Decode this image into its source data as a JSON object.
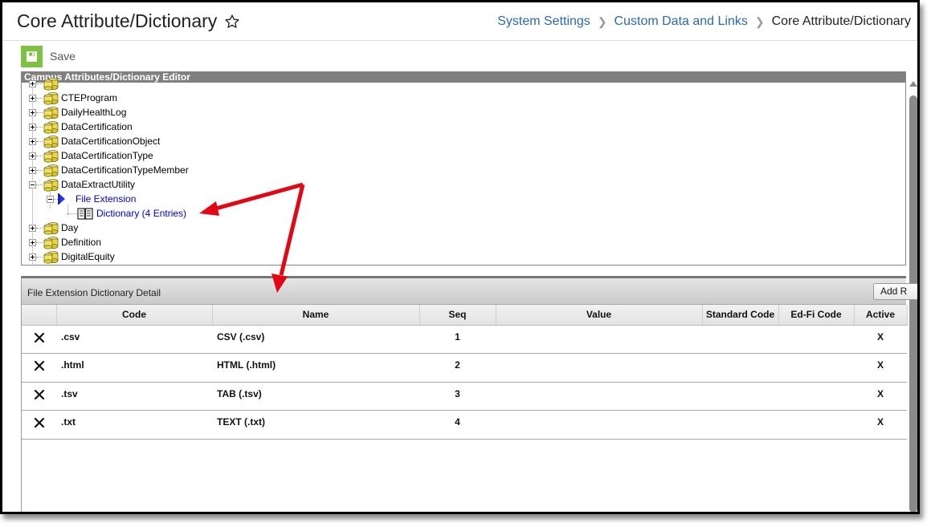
{
  "header": {
    "title": "Core Attribute/Dictionary",
    "breadcrumb": [
      {
        "label": "System Settings"
      },
      {
        "label": "Custom Data and Links"
      },
      {
        "label": "Core Attribute/Dictionary"
      }
    ]
  },
  "toolbar": {
    "save_label": "Save"
  },
  "tree": {
    "header": "Campus Attributes/Dictionary Editor",
    "items": [
      {
        "label": "CTEProgram",
        "expanded": false
      },
      {
        "label": "DailyHealthLog",
        "expanded": false
      },
      {
        "label": "DataCertification",
        "expanded": false
      },
      {
        "label": "DataCertificationObject",
        "expanded": false
      },
      {
        "label": "DataCertificationType",
        "expanded": false
      },
      {
        "label": "DataCertificationTypeMember",
        "expanded": false
      },
      {
        "label": "DataExtractUtility",
        "expanded": true
      },
      {
        "label": "File Extension",
        "expanded": true
      },
      {
        "label": "Dictionary (4 Entries)"
      },
      {
        "label": "Day",
        "expanded": false
      },
      {
        "label": "Definition",
        "expanded": false
      },
      {
        "label": "DigitalEquity",
        "expanded": false
      }
    ]
  },
  "detail": {
    "title": "File Extension Dictionary Detail",
    "add_button": "Add R",
    "columns": [
      "",
      "Code",
      "Name",
      "Seq",
      "Value",
      "Standard Code",
      "Ed-Fi Code",
      "Active"
    ],
    "rows": [
      {
        "code": ".csv",
        "name": "CSV (.csv)",
        "seq": "1",
        "value": "",
        "standard_code": "",
        "edfi_code": "",
        "active": "X"
      },
      {
        "code": ".html",
        "name": "HTML (.html)",
        "seq": "2",
        "value": "",
        "standard_code": "",
        "edfi_code": "",
        "active": "X"
      },
      {
        "code": ".tsv",
        "name": "TAB (.tsv)",
        "seq": "3",
        "value": "",
        "standard_code": "",
        "edfi_code": "",
        "active": "X"
      },
      {
        "code": ".txt",
        "name": "TEXT (.txt)",
        "seq": "4",
        "value": "",
        "standard_code": "",
        "edfi_code": "",
        "active": "X"
      }
    ]
  },
  "colors": {
    "accent_link": "#2a6ab0",
    "save_green": "#7dc242",
    "tree_header": "#808080",
    "annotation_red": "#e30613"
  }
}
